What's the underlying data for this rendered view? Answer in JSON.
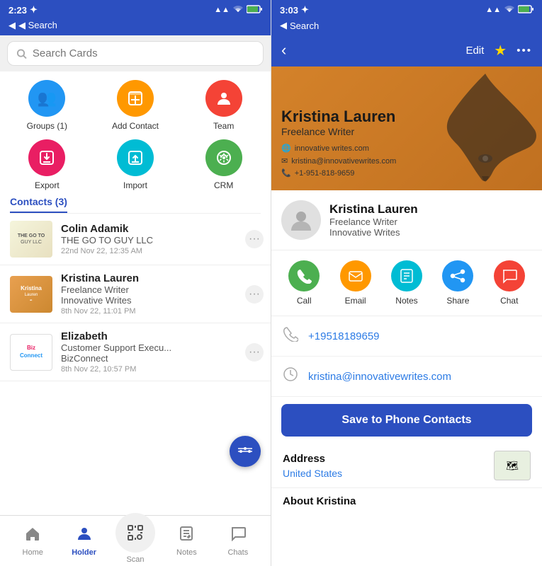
{
  "left": {
    "statusBar": {
      "time": "2:23",
      "timeIcon": "✈",
      "backLabel": "◀ Search",
      "signal": "▲▲",
      "wifi": "WiFi",
      "battery": "🔋"
    },
    "search": {
      "placeholder": "Search Cards"
    },
    "quickActions": [
      {
        "id": "groups",
        "label": "Groups (1)",
        "icon": "👥",
        "color": "#2196F3"
      },
      {
        "id": "add-contact",
        "label": "Add Contact",
        "icon": "📦",
        "color": "#FF9800"
      },
      {
        "id": "team",
        "label": "Team",
        "icon": "👤",
        "color": "#F44336"
      },
      {
        "id": "export",
        "label": "Export",
        "icon": "📤",
        "color": "#E91E63"
      },
      {
        "id": "import",
        "label": "Import",
        "icon": "📥",
        "color": "#00BCD4"
      },
      {
        "id": "crm",
        "label": "CRM",
        "icon": "🔄",
        "color": "#4CAF50"
      }
    ],
    "contactsHeader": "Contacts (3)",
    "contacts": [
      {
        "id": "colin",
        "name": "Colin Adamik",
        "company": "THE GO TO GUY LLC",
        "time": "22nd Nov 22, 12:35 AM",
        "cardBg": "#f5f5dc"
      },
      {
        "id": "kristina",
        "name": "Kristina Lauren",
        "title": "Freelance Writer",
        "company": "Innovative Writes",
        "time": "8th Nov 22, 11:01 PM",
        "cardBg": "#e8a050"
      },
      {
        "id": "elizabeth",
        "name": "Elizabeth",
        "title": "Customer Support Execu...",
        "company": "BizConnect",
        "time": "8th Nov 22, 10:57 PM",
        "cardBg": "#ffffff"
      }
    ],
    "bottomNav": [
      {
        "id": "home",
        "label": "Home",
        "icon": "⌂",
        "active": false
      },
      {
        "id": "holder",
        "label": "Holder",
        "icon": "👤",
        "active": true
      },
      {
        "id": "scan",
        "label": "Scan",
        "icon": "📷",
        "active": false
      },
      {
        "id": "notes",
        "label": "Notes",
        "icon": "✏",
        "active": false
      },
      {
        "id": "chats",
        "label": "Chats",
        "icon": "💬",
        "active": false
      }
    ]
  },
  "right": {
    "statusBar": {
      "time": "3:03",
      "timeIcon": "✈",
      "backLabel": "◀ Search",
      "signal": "▲▲",
      "wifi": "WiFi",
      "battery": "🔋"
    },
    "header": {
      "backLabel": "‹",
      "editLabel": "Edit",
      "starFilled": true,
      "moreLabel": "•••"
    },
    "businessCard": {
      "name": "Kristina Lauren",
      "title": "Freelance Writer",
      "website": "innovative writes.com",
      "email": "kristina@innovativewrites.com",
      "phone": "+1-951-818-9659"
    },
    "profile": {
      "name": "Kristina Lauren",
      "title": "Freelance Writer",
      "company": "Innovative Writes"
    },
    "actionButtons": [
      {
        "id": "call",
        "label": "Call",
        "icon": "📞",
        "color": "#4CAF50"
      },
      {
        "id": "email",
        "label": "Email",
        "icon": "✉",
        "color": "#FF9800"
      },
      {
        "id": "notes",
        "label": "Notes",
        "icon": "💬",
        "color": "#00BCD4"
      },
      {
        "id": "share",
        "label": "Share",
        "icon": "↗",
        "color": "#2196F3"
      },
      {
        "id": "chat",
        "label": "Chat",
        "icon": "💬",
        "color": "#F44336"
      }
    ],
    "phone": "+19518189659",
    "email": "kristina@innovativewrites.com",
    "saveBtnLabel": "Save to Phone Contacts",
    "addressHeading": "Address",
    "addressValue": "United States",
    "aboutHeading": "About Kristina"
  }
}
